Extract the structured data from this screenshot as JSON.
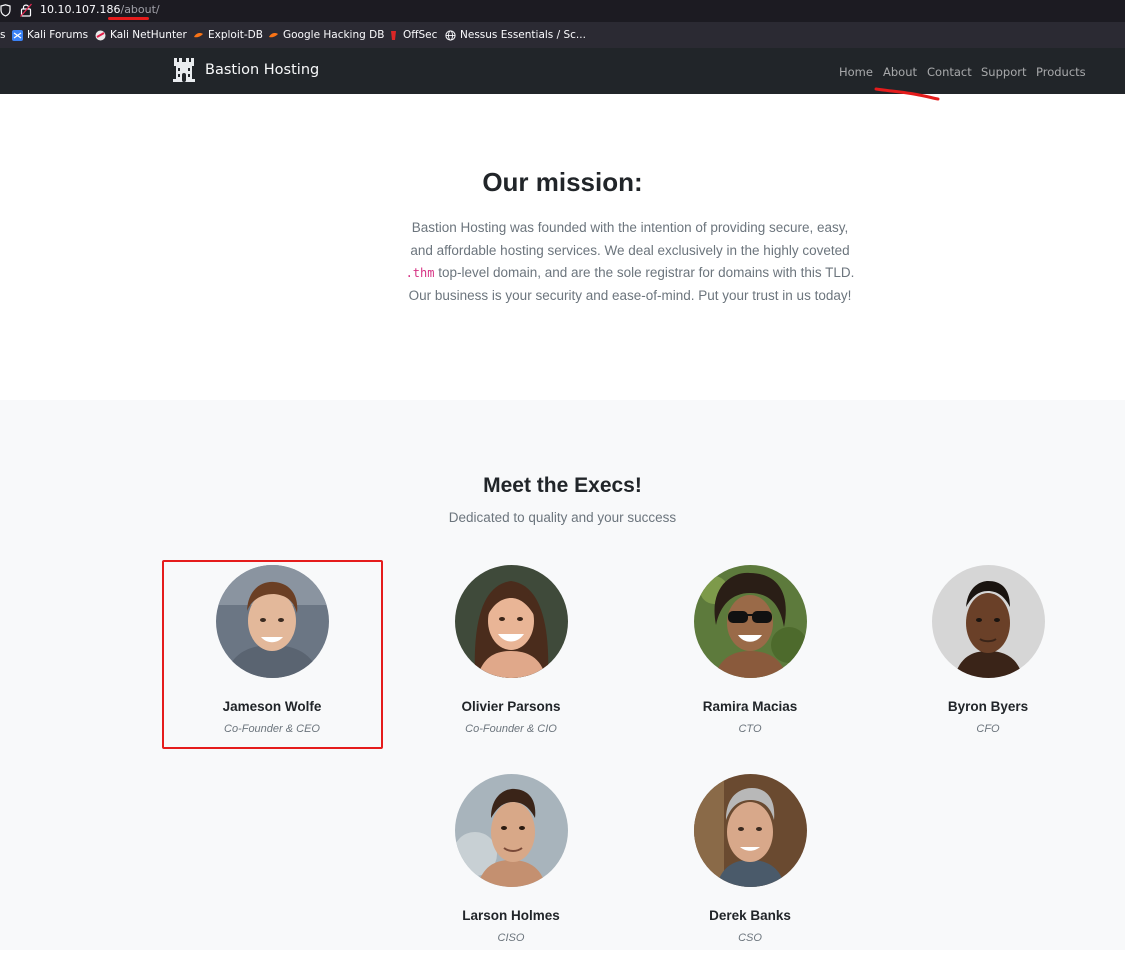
{
  "browser": {
    "url_host": "10.10.107.186",
    "url_path": "/about/",
    "bookmarks": [
      {
        "label": "s",
        "icon": "bookmark-icon"
      },
      {
        "label": "Kali Forums",
        "icon": "kali-forums-icon"
      },
      {
        "label": "Kali NetHunter",
        "icon": "kali-nethunter-icon"
      },
      {
        "label": "Exploit-DB",
        "icon": "exploit-db-icon"
      },
      {
        "label": "Google Hacking DB",
        "icon": "ghdb-icon"
      },
      {
        "label": "OffSec",
        "icon": "offsec-icon"
      },
      {
        "label": "Nessus Essentials / Sc...",
        "icon": "globe-icon"
      }
    ]
  },
  "navbar": {
    "brand": "Bastion Hosting",
    "links": [
      "Home",
      "About",
      "Contact",
      "Support",
      "Products"
    ]
  },
  "mission": {
    "title": "Our mission:",
    "text_before": "Bastion Hosting was founded with the intention of providing secure, easy, and affordable hosting services. We deal exclusively in the highly coveted ",
    "code": ".thm",
    "text_after": " top-level domain, and are the sole registrar for domains with this TLD. Our business is your security and ease-of-mind. Put your trust in us today!"
  },
  "execs": {
    "title": "Meet the Execs!",
    "subtitle": "Dedicated to quality and your success",
    "people": [
      {
        "name": "Jameson Wolfe",
        "role": "Co-Founder & CEO"
      },
      {
        "name": "Olivier Parsons",
        "role": "Co-Founder & CIO"
      },
      {
        "name": "Ramira Macias",
        "role": "CTO"
      },
      {
        "name": "Byron Byers",
        "role": "CFO"
      },
      {
        "name": "Larson Holmes",
        "role": "CISO"
      },
      {
        "name": "Derek Banks",
        "role": "CSO"
      }
    ]
  },
  "colors": {
    "navbar": "#212529",
    "annotation_red": "#e51c1c",
    "code_pink": "#d63384",
    "section_bg": "#f8f9fa"
  }
}
